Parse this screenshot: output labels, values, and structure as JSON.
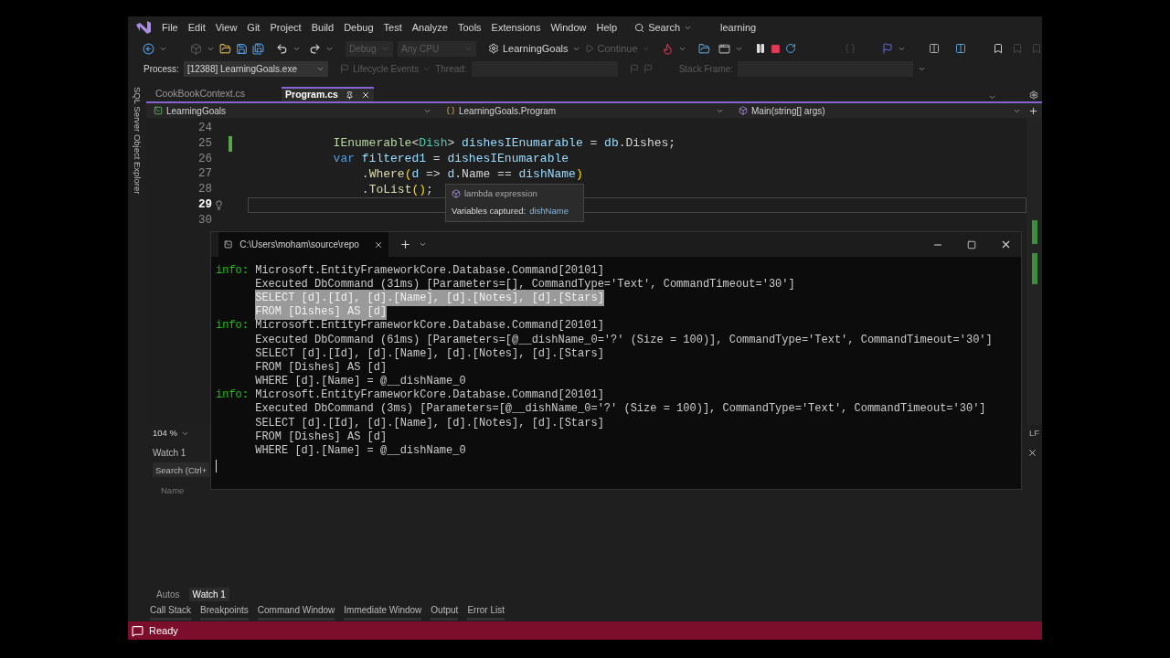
{
  "menu": {
    "items": [
      "File",
      "Edit",
      "View",
      "Git",
      "Project",
      "Build",
      "Debug",
      "Test",
      "Analyze",
      "Tools",
      "Extensions",
      "Window",
      "Help"
    ],
    "search": "Search",
    "solution": "learning"
  },
  "toolbar": {
    "configuration": {
      "label": "Debug",
      "disabled": true
    },
    "platform": {
      "label": "Any CPU",
      "disabled": true
    },
    "startup": "LearningGoals",
    "continue": {
      "label": "Continue",
      "disabled": true
    }
  },
  "debug_location": {
    "process_label": "Process:",
    "process": "[12388] LearningGoals.exe",
    "lifecycle": {
      "label": "Lifecycle Events",
      "disabled": true
    },
    "thread": {
      "label": "Thread:",
      "disabled": true
    },
    "stack_frame": {
      "label": "Stack Frame:",
      "disabled": true
    }
  },
  "side_tab": "SQL Server Object Explorer",
  "doc_tabs": [
    {
      "label": "CookBookContext.cs",
      "selected": false
    },
    {
      "label": "Program.cs",
      "selected": true
    }
  ],
  "nav_bar": {
    "project": "LearningGoals",
    "type": "LearningGoals.Program",
    "member": "Main(string[] args)"
  },
  "editor": {
    "lines": [
      {
        "number": "24",
        "current": false,
        "changed": false
      },
      {
        "number": "25",
        "current": false,
        "changed": true,
        "kind": "statement",
        "segments": [
          {
            "text": "IEnumerable",
            "kind": "interface"
          },
          {
            "text": "<",
            "kind": "plain"
          },
          {
            "text": "Dish",
            "kind": "type"
          },
          {
            "text": "> ",
            "kind": "plain"
          },
          {
            "text": "dishesIEnumarable",
            "kind": "variable"
          },
          {
            "text": " = ",
            "kind": "plain"
          },
          {
            "text": "db",
            "kind": "variable"
          },
          {
            "text": ".Dishes;",
            "kind": "plain"
          }
        ]
      },
      {
        "number": "26",
        "current": false,
        "changed": false,
        "kind": "statement",
        "segments": [
          {
            "text": "var",
            "kind": "keyword"
          },
          {
            "text": " filtered1",
            "kind": "variable"
          },
          {
            "text": " = ",
            "kind": "plain"
          },
          {
            "text": "dishesIEnumarable",
            "kind": "variable"
          }
        ]
      },
      {
        "number": "27",
        "current": false,
        "changed": false,
        "kind": "chained",
        "segments": [
          {
            "text": ".",
            "kind": "plain"
          },
          {
            "text": "Where",
            "kind": "method"
          },
          {
            "text": "(",
            "kind": "bracket"
          },
          {
            "text": "d",
            "kind": "variable"
          },
          {
            "text": " => ",
            "kind": "plain"
          },
          {
            "text": "d",
            "kind": "variable"
          },
          {
            "text": ".Name == ",
            "kind": "plain"
          },
          {
            "text": "dishName",
            "kind": "variable"
          },
          {
            "text": ")",
            "kind": "bracket"
          }
        ]
      },
      {
        "number": "28",
        "current": false,
        "changed": false,
        "kind": "chained",
        "segments": [
          {
            "text": ".",
            "kind": "plain"
          },
          {
            "text": "ToList",
            "kind": "method"
          },
          {
            "text": "()",
            "kind": "bracket"
          },
          {
            "text": ";",
            "kind": "plain"
          }
        ]
      },
      {
        "number": "29",
        "current": true,
        "changed": false
      },
      {
        "number": "30",
        "current": false,
        "changed": false
      }
    ],
    "tooltip": {
      "title": "lambda expression",
      "captured_label": "Variables captured:",
      "captured": "dishName"
    },
    "zoom": "104 %",
    "line_ending": "LF"
  },
  "terminal": {
    "title": "C:\\Users\\moham\\source\\repo",
    "lines": [
      {
        "kind": "info",
        "prefix": "info:",
        "text": "Microsoft.EntityFrameworkCore.Database.Command[20101]",
        "selected": false
      },
      {
        "text": "Executed DbCommand (31ms) [Parameters=[], CommandType='Text', CommandTimeout='30']",
        "selected": false
      },
      {
        "text": "SELECT [d].[Id], [d].[Name], [d].[Notes], [d].[Stars]",
        "selected": true
      },
      {
        "text": "FROM [Dishes] AS [d]",
        "selected": true
      },
      {
        "kind": "info",
        "prefix": "info:",
        "text": "Microsoft.EntityFrameworkCore.Database.Command[20101]",
        "selected": false
      },
      {
        "text": "Executed DbCommand (61ms) [Parameters=[@__dishName_0='?' (Size = 100)], CommandType='Text', CommandTimeout='30']",
        "selected": false
      },
      {
        "text": "SELECT [d].[Id], [d].[Name], [d].[Notes], [d].[Stars]",
        "selected": false
      },
      {
        "text": "FROM [Dishes] AS [d]",
        "selected": false
      },
      {
        "text": "WHERE [d].[Name] = @__dishName_0",
        "selected": false
      },
      {
        "kind": "info",
        "prefix": "info:",
        "text": "Microsoft.EntityFrameworkCore.Database.Command[20101]",
        "selected": false
      },
      {
        "text": "Executed DbCommand (3ms) [Parameters=[@__dishName_0='?' (Size = 100)], CommandType='Text', CommandTimeout='30']",
        "selected": false
      },
      {
        "text": "SELECT [d].[Id], [d].[Name], [d].[Notes], [d].[Stars]",
        "selected": false
      },
      {
        "text": "FROM [Dishes] AS [d]",
        "selected": false
      },
      {
        "text": "WHERE [d].[Name] = @__dishName_0",
        "selected": false
      }
    ]
  },
  "watch": {
    "title": "Watch 1",
    "search_placeholder": "Search (Ctrl+",
    "columns": [
      "Name"
    ]
  },
  "debug_tabs": [
    {
      "label": "Autos",
      "selected": false
    },
    {
      "label": "Watch 1",
      "selected": true
    }
  ],
  "tool_tabs": [
    "Call Stack",
    "Breakpoints",
    "Command Window",
    "Immediate Window",
    "Output",
    "Error List"
  ],
  "status_bar": {
    "text": "Ready"
  }
}
